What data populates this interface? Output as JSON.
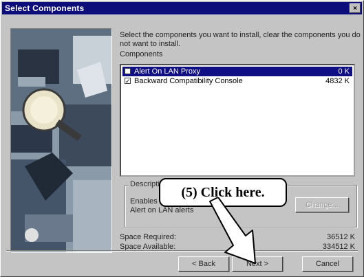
{
  "window": {
    "title": "Select Components",
    "close_glyph": "×"
  },
  "instruction": "Select the components you want to install, clear the components you do not want to install.",
  "components_label": "Components",
  "components": [
    {
      "name": "Alert On LAN Proxy",
      "size": "0 K",
      "checked": false,
      "selected": true
    },
    {
      "name": "Backward Compatibility Console",
      "size": "4832 K",
      "checked": true,
      "selected": false
    }
  ],
  "description": {
    "label": "Description",
    "text": "Enables this computer to receive Alert on LAN alerts",
    "change_button": "Change..."
  },
  "space": {
    "required_label": "Space Required:",
    "required_value": "36512 K",
    "available_label": "Space Available:",
    "available_value": "334512 K"
  },
  "buttons": {
    "back": "< Back",
    "next": "Next >",
    "cancel": "Cancel"
  },
  "callout": "(5)  Click here.",
  "colors": {
    "titlebar": "#0c0c7a",
    "selection": "#101084",
    "dialog": "#c4c4c4"
  }
}
